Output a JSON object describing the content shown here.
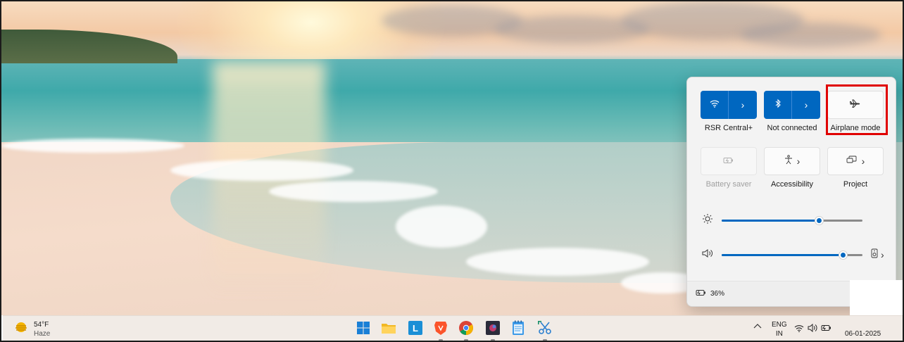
{
  "quick_settings": {
    "tiles": [
      {
        "label": "RSR Central+",
        "icon": "wifi-icon",
        "state": "on"
      },
      {
        "label": "Not connected",
        "icon": "bluetooth-icon",
        "state": "on"
      },
      {
        "label": "Airplane mode",
        "icon": "airplane-icon",
        "state": "off"
      },
      {
        "label": "Battery saver",
        "icon": "battery-saver-icon",
        "state": "disabled"
      },
      {
        "label": "Accessibility",
        "icon": "accessibility-icon",
        "state": "off"
      },
      {
        "label": "Project",
        "icon": "project-icon",
        "state": "off"
      }
    ],
    "brightness": {
      "icon": "brightness-icon",
      "level": 0.69
    },
    "volume": {
      "icon": "volume-icon",
      "level": 0.86
    },
    "battery_text": "36%"
  },
  "taskbar": {
    "weather": {
      "temp": "54°F",
      "condition": "Haze",
      "icon": "weather-haze-icon"
    },
    "apps": [
      {
        "name": "start-button",
        "icon": "windows-logo-icon",
        "running": false
      },
      {
        "name": "file-explorer",
        "icon": "folder-icon",
        "running": false
      },
      {
        "name": "app-l",
        "icon": "l-app-icon",
        "running": false
      },
      {
        "name": "brave-browser",
        "icon": "brave-icon",
        "running": true
      },
      {
        "name": "chrome-browser",
        "icon": "chrome-icon",
        "running": true
      },
      {
        "name": "media-app",
        "icon": "media-app-icon",
        "running": true
      },
      {
        "name": "notepad",
        "icon": "notepad-icon",
        "running": false
      },
      {
        "name": "snipping-tool",
        "icon": "snipping-tool-icon",
        "running": true
      }
    ],
    "language": {
      "line1": "ENG",
      "line2": "IN"
    },
    "clock_date": "06-01-2025"
  },
  "colors": {
    "accent": "#0067c0",
    "highlight_box": "#e00000"
  }
}
